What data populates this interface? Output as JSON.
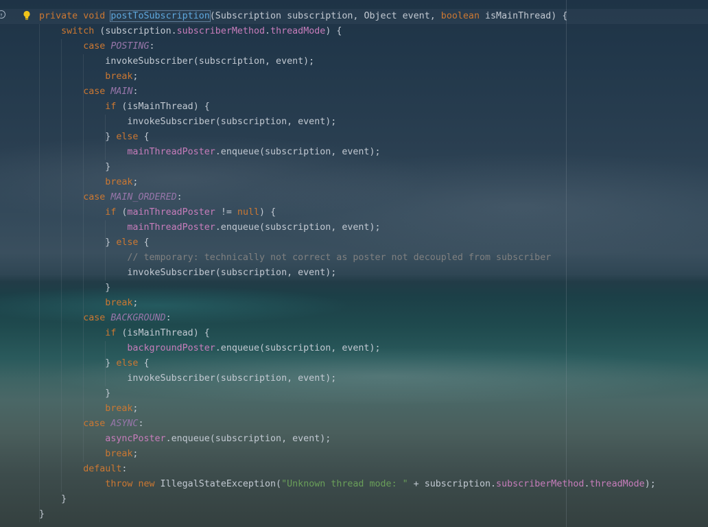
{
  "editor": {
    "gutter_icons": [
      "override-marker-icon",
      "lightbulb-icon"
    ],
    "lines": [
      [
        [
          "kw",
          "private void "
        ],
        [
          "fn",
          "postToSubscription"
        ],
        [
          "p",
          "(Subscription subscription, Object event, "
        ],
        [
          "kw",
          "boolean"
        ],
        [
          "p",
          " isMainThread) {"
        ]
      ],
      [
        [
          "p",
          "    "
        ],
        [
          "kw",
          "switch"
        ],
        [
          "p",
          " (subscription."
        ],
        [
          "fld",
          "subscriberMethod"
        ],
        [
          "p",
          "."
        ],
        [
          "fld",
          "threadMode"
        ],
        [
          "p",
          ") {"
        ]
      ],
      [
        [
          "p",
          "        "
        ],
        [
          "kw",
          "case "
        ],
        [
          "ct",
          "POSTING"
        ],
        [
          "p",
          ":"
        ]
      ],
      [
        [
          "p",
          "            invokeSubscriber(subscription, event);"
        ]
      ],
      [
        [
          "p",
          "            "
        ],
        [
          "kw",
          "break"
        ],
        [
          "p",
          ";"
        ]
      ],
      [
        [
          "p",
          "        "
        ],
        [
          "kw",
          "case "
        ],
        [
          "ct",
          "MAIN"
        ],
        [
          "p",
          ":"
        ]
      ],
      [
        [
          "p",
          "            "
        ],
        [
          "kw",
          "if"
        ],
        [
          "p",
          " (isMainThread) {"
        ]
      ],
      [
        [
          "p",
          "                invokeSubscriber(subscription, event);"
        ]
      ],
      [
        [
          "p",
          "            } "
        ],
        [
          "kw",
          "else"
        ],
        [
          "p",
          " {"
        ]
      ],
      [
        [
          "p",
          "                "
        ],
        [
          "fld",
          "mainThreadPoster"
        ],
        [
          "p",
          ".enqueue(subscription, event);"
        ]
      ],
      [
        [
          "p",
          "            }"
        ]
      ],
      [
        [
          "p",
          "            "
        ],
        [
          "kw",
          "break"
        ],
        [
          "p",
          ";"
        ]
      ],
      [
        [
          "p",
          "        "
        ],
        [
          "kw",
          "case "
        ],
        [
          "ct",
          "MAIN_ORDERED"
        ],
        [
          "p",
          ":"
        ]
      ],
      [
        [
          "p",
          "            "
        ],
        [
          "kw",
          "if"
        ],
        [
          "p",
          " ("
        ],
        [
          "fld",
          "mainThreadPoster"
        ],
        [
          "p",
          " != "
        ],
        [
          "kw",
          "null"
        ],
        [
          "p",
          ") {"
        ]
      ],
      [
        [
          "p",
          "                "
        ],
        [
          "fld",
          "mainThreadPoster"
        ],
        [
          "p",
          ".enqueue(subscription, event);"
        ]
      ],
      [
        [
          "p",
          "            } "
        ],
        [
          "kw",
          "else"
        ],
        [
          "p",
          " {"
        ]
      ],
      [
        [
          "p",
          "                "
        ],
        [
          "cmt",
          "// temporary: technically not correct as poster not decoupled from subscriber"
        ]
      ],
      [
        [
          "p",
          "                invokeSubscriber(subscription, event);"
        ]
      ],
      [
        [
          "p",
          "            }"
        ]
      ],
      [
        [
          "p",
          "            "
        ],
        [
          "kw",
          "break"
        ],
        [
          "p",
          ";"
        ]
      ],
      [
        [
          "p",
          "        "
        ],
        [
          "kw",
          "case "
        ],
        [
          "ct",
          "BACKGROUND"
        ],
        [
          "p",
          ":"
        ]
      ],
      [
        [
          "p",
          "            "
        ],
        [
          "kw",
          "if"
        ],
        [
          "p",
          " (isMainThread) {"
        ]
      ],
      [
        [
          "p",
          "                "
        ],
        [
          "fld",
          "backgroundPoster"
        ],
        [
          "p",
          ".enqueue(subscription, event);"
        ]
      ],
      [
        [
          "p",
          "            } "
        ],
        [
          "kw",
          "else"
        ],
        [
          "p",
          " {"
        ]
      ],
      [
        [
          "p",
          "                invokeSubscriber(subscription, event);"
        ]
      ],
      [
        [
          "p",
          "            }"
        ]
      ],
      [
        [
          "p",
          "            "
        ],
        [
          "kw",
          "break"
        ],
        [
          "p",
          ";"
        ]
      ],
      [
        [
          "p",
          "        "
        ],
        [
          "kw",
          "case "
        ],
        [
          "ct",
          "ASYNC"
        ],
        [
          "p",
          ":"
        ]
      ],
      [
        [
          "p",
          "            "
        ],
        [
          "fld",
          "asyncPoster"
        ],
        [
          "p",
          ".enqueue(subscription, event);"
        ]
      ],
      [
        [
          "p",
          "            "
        ],
        [
          "kw",
          "break"
        ],
        [
          "p",
          ";"
        ]
      ],
      [
        [
          "p",
          "        "
        ],
        [
          "kw",
          "default"
        ],
        [
          "p",
          ":"
        ]
      ],
      [
        [
          "p",
          "            "
        ],
        [
          "kw",
          "throw new "
        ],
        [
          "p",
          "IllegalStateException("
        ],
        [
          "str",
          "\"Unknown thread mode: \""
        ],
        [
          "p",
          " + subscription."
        ],
        [
          "fld",
          "subscriberMethod"
        ],
        [
          "p",
          "."
        ],
        [
          "fld",
          "threadMode"
        ],
        [
          "p",
          ");"
        ]
      ],
      [
        [
          "p",
          "    }"
        ]
      ],
      [
        [
          "p",
          "}"
        ]
      ]
    ]
  },
  "colors": {
    "keyword": "#cc7832",
    "constant": "#9876aa",
    "field": "#c77dbb",
    "string": "#6a9f59",
    "comment": "#808080",
    "method_highlight": "#5fa8de",
    "plain": "#c2c9d2"
  }
}
